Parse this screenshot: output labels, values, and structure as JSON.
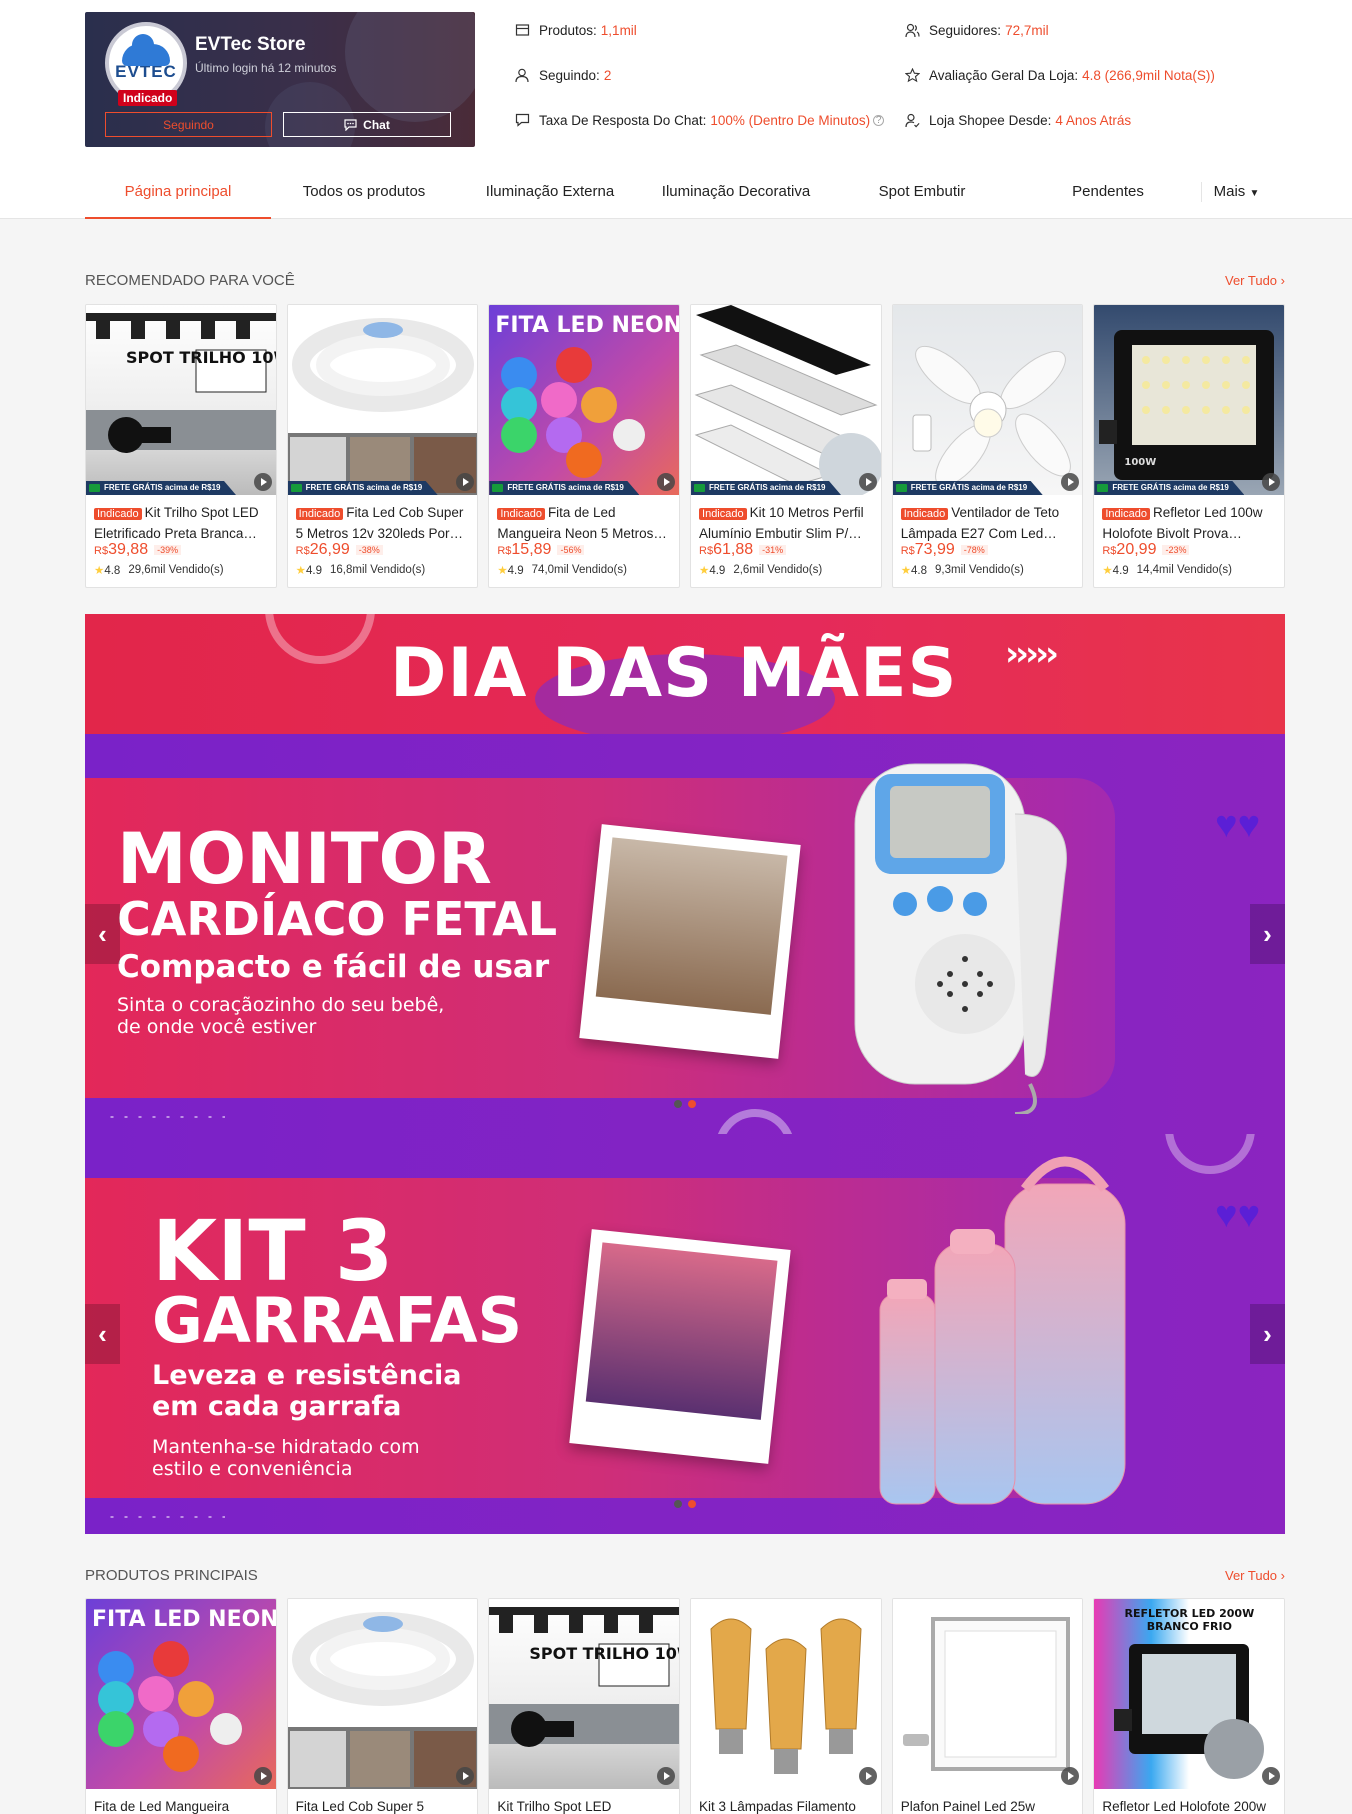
{
  "shop": {
    "name": "EVTec Store",
    "last_login": "Último login há 12 minutos",
    "logo_text": "EVTEC",
    "tag": "Indicado",
    "follow_label": "Seguindo",
    "chat_label": "Chat"
  },
  "stats": {
    "produtos_label": "Produtos:",
    "produtos_value": "1,1mil",
    "seguidores_label": "Seguidores:",
    "seguidores_value": "72,7mil",
    "seguindo_label": "Seguindo:",
    "seguindo_value": "2",
    "avaliacao_label": "Avaliação Geral Da Loja:",
    "avaliacao_value": "4.8 (266,9mil Nota(S))",
    "taxa_label": "Taxa De Resposta Do Chat:",
    "taxa_value": "100% (Dentro De Minutos)",
    "desde_label": "Loja Shopee Desde:",
    "desde_value": "4 Anos Atrás"
  },
  "tabs": [
    "Página principal",
    "Todos os produtos",
    "Iluminação Externa",
    "Iluminação Decorativa",
    "Spot Embutir",
    "Pendentes",
    "Mais"
  ],
  "recommended": {
    "title": "RECOMENDADO PARA VOCÊ",
    "see_all": "Ver Tudo",
    "frete": "FRETE GRÁTIS acima de R$19",
    "tag": "Indicado",
    "items": [
      {
        "name": "Kit Trilho Spot LED Eletrificado Preta Branca…",
        "cur": "R$",
        "price": "39,88",
        "disc": "-39%",
        "rating": "4.8",
        "sold": "29,6mil Vendido(s)",
        "img_text": "SPOT TRILHO 10W"
      },
      {
        "name": "Fita Led Cob Super 5 Metros 12v 320leds Por…",
        "cur": "R$",
        "price": "26,99",
        "disc": "-38%",
        "rating": "4.9",
        "sold": "16,8mil Vendido(s)",
        "img_text": ""
      },
      {
        "name": "Fita de Led Mangueira Neon 5 Metros…",
        "cur": "R$",
        "price": "15,89",
        "disc": "-56%",
        "rating": "4.9",
        "sold": "74,0mil Vendido(s)",
        "img_text": "FITA LED NEON"
      },
      {
        "name": "Kit 10 Metros Perfil Alumínio Embutir Slim P/…",
        "cur": "R$",
        "price": "61,88",
        "disc": "-31%",
        "rating": "4.9",
        "sold": "2,6mil Vendido(s)",
        "img_text": ""
      },
      {
        "name": "Ventilador de Teto Lâmpada E27 Com Led…",
        "cur": "R$",
        "price": "73,99",
        "disc": "-78%",
        "rating": "4.8",
        "sold": "9,3mil Vendido(s)",
        "img_text": ""
      },
      {
        "name": "Refletor Led 100w Holofote Bivolt Prova…",
        "cur": "R$",
        "price": "20,99",
        "disc": "-23%",
        "rating": "4.9",
        "sold": "14,4mil Vendido(s)",
        "img_text": "100W"
      }
    ]
  },
  "banner_top": {
    "title": "DIA DAS MÃES"
  },
  "banner1": {
    "line1": "MONITOR",
    "line2": "CARDÍACO FETAL",
    "line3": "Compacto e fácil de usar",
    "line4": "Sinta o coraçãozinho do seu bebê,",
    "line5": "de onde você estiver"
  },
  "banner2": {
    "line1": "KIT 3",
    "line2": "GARRAFAS",
    "line3": "Leveza e resistência",
    "line4": "em cada garrafa",
    "line5": "Mantenha-se hidratado com",
    "line6": "estilo e conveniência"
  },
  "main_products": {
    "title": "PRODUTOS PRINCIPAIS",
    "see_all": "Ver Tudo",
    "items": [
      {
        "name": "Fita de Led Mangueira",
        "img_text": "FITA LED NEON"
      },
      {
        "name": "Fita Led Cob Super 5",
        "img_text": ""
      },
      {
        "name": "Kit Trilho Spot LED",
        "img_text": "SPOT TRILHO 10W"
      },
      {
        "name": "Kit 3 Lâmpadas Filamento",
        "img_text": ""
      },
      {
        "name": "Plafon Painel Led 25w",
        "img_text": ""
      },
      {
        "name": "Refletor Led Holofote 200w",
        "img_text": "REFLETOR LED 200W BRANCO FRIO"
      }
    ]
  },
  "colors": {
    "accent": "#ee4d2d",
    "banner_red": "#e0283f",
    "banner_purple": "#6a1fc4"
  }
}
